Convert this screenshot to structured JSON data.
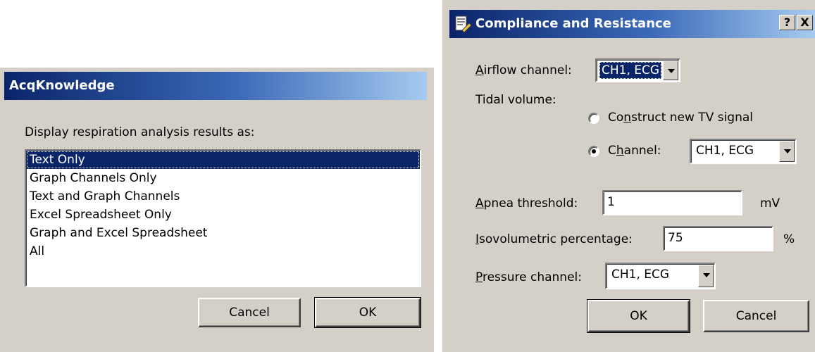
{
  "dialog1": {
    "title": "AcqKnowledge",
    "prompt": "Display respiration analysis results as:",
    "options": [
      "Text Only",
      "Graph Channels Only",
      "Text and Graph Channels",
      "Excel Spreadsheet Only",
      "Graph and Excel Spreadsheet",
      "All"
    ],
    "selected_index": 0,
    "cancel_label": "Cancel",
    "ok_label": "OK"
  },
  "dialog2": {
    "title": "Compliance and Resistance",
    "help_button": "?",
    "close_button": "X",
    "airflow_label_u": "A",
    "airflow_label_rest": "irflow channel:",
    "airflow_value": "CH1, ECG",
    "tidal_label": "Tidal volume:",
    "radio_construct_pre": "Co",
    "radio_construct_u": "n",
    "radio_construct_post": "struct new TV signal",
    "radio_channel_pre": "C",
    "radio_channel_u": "h",
    "radio_channel_post": "annel:",
    "tidal_channel_value": "CH1, ECG",
    "apnea_label_u": "A",
    "apnea_label_rest": "pnea threshold:",
    "apnea_value": "1",
    "apnea_unit": "mV",
    "iso_label_u": "I",
    "iso_label_rest": "sovolumetric percentage:",
    "iso_value": "75",
    "iso_unit": "%",
    "pressure_label_u": "P",
    "pressure_label_rest": "ressure channel:",
    "pressure_value": "CH1, ECG",
    "ok_label": "OK",
    "cancel_label": "Cancel",
    "selected_radio": "channel"
  },
  "icons": {
    "dialog2_title_icon": "document-edit-icon",
    "combo_arrow": "chevron-down-icon"
  }
}
